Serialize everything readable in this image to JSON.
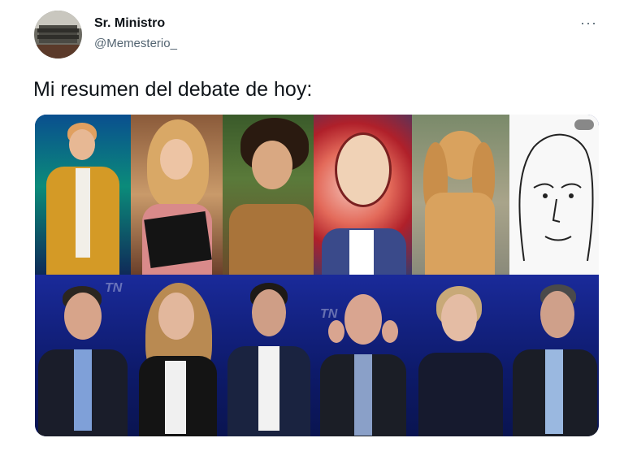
{
  "author": {
    "display_name": "Sr. Ministro",
    "handle": "@Memesterio_"
  },
  "menu": {
    "more_label": "···"
  },
  "tweet": {
    "text": "Mi resumen del debate de hoy:"
  },
  "media": {
    "top_row": [
      "gold-suit-man",
      "blonde-wig-woman-with-book",
      "bearded-wild-hair-man",
      "cartoon-hypnotized-man",
      "cocker-spaniel-dog",
      "wojak-face-drawing"
    ],
    "bottom_row": [
      "candidate-1",
      "candidate-2",
      "candidate-3",
      "candidate-4-ears-covered",
      "candidate-5",
      "candidate-6"
    ]
  },
  "colors": {
    "text_primary": "#0f1419",
    "text_secondary": "#536471",
    "studio_blue": "#1a2a9a"
  }
}
